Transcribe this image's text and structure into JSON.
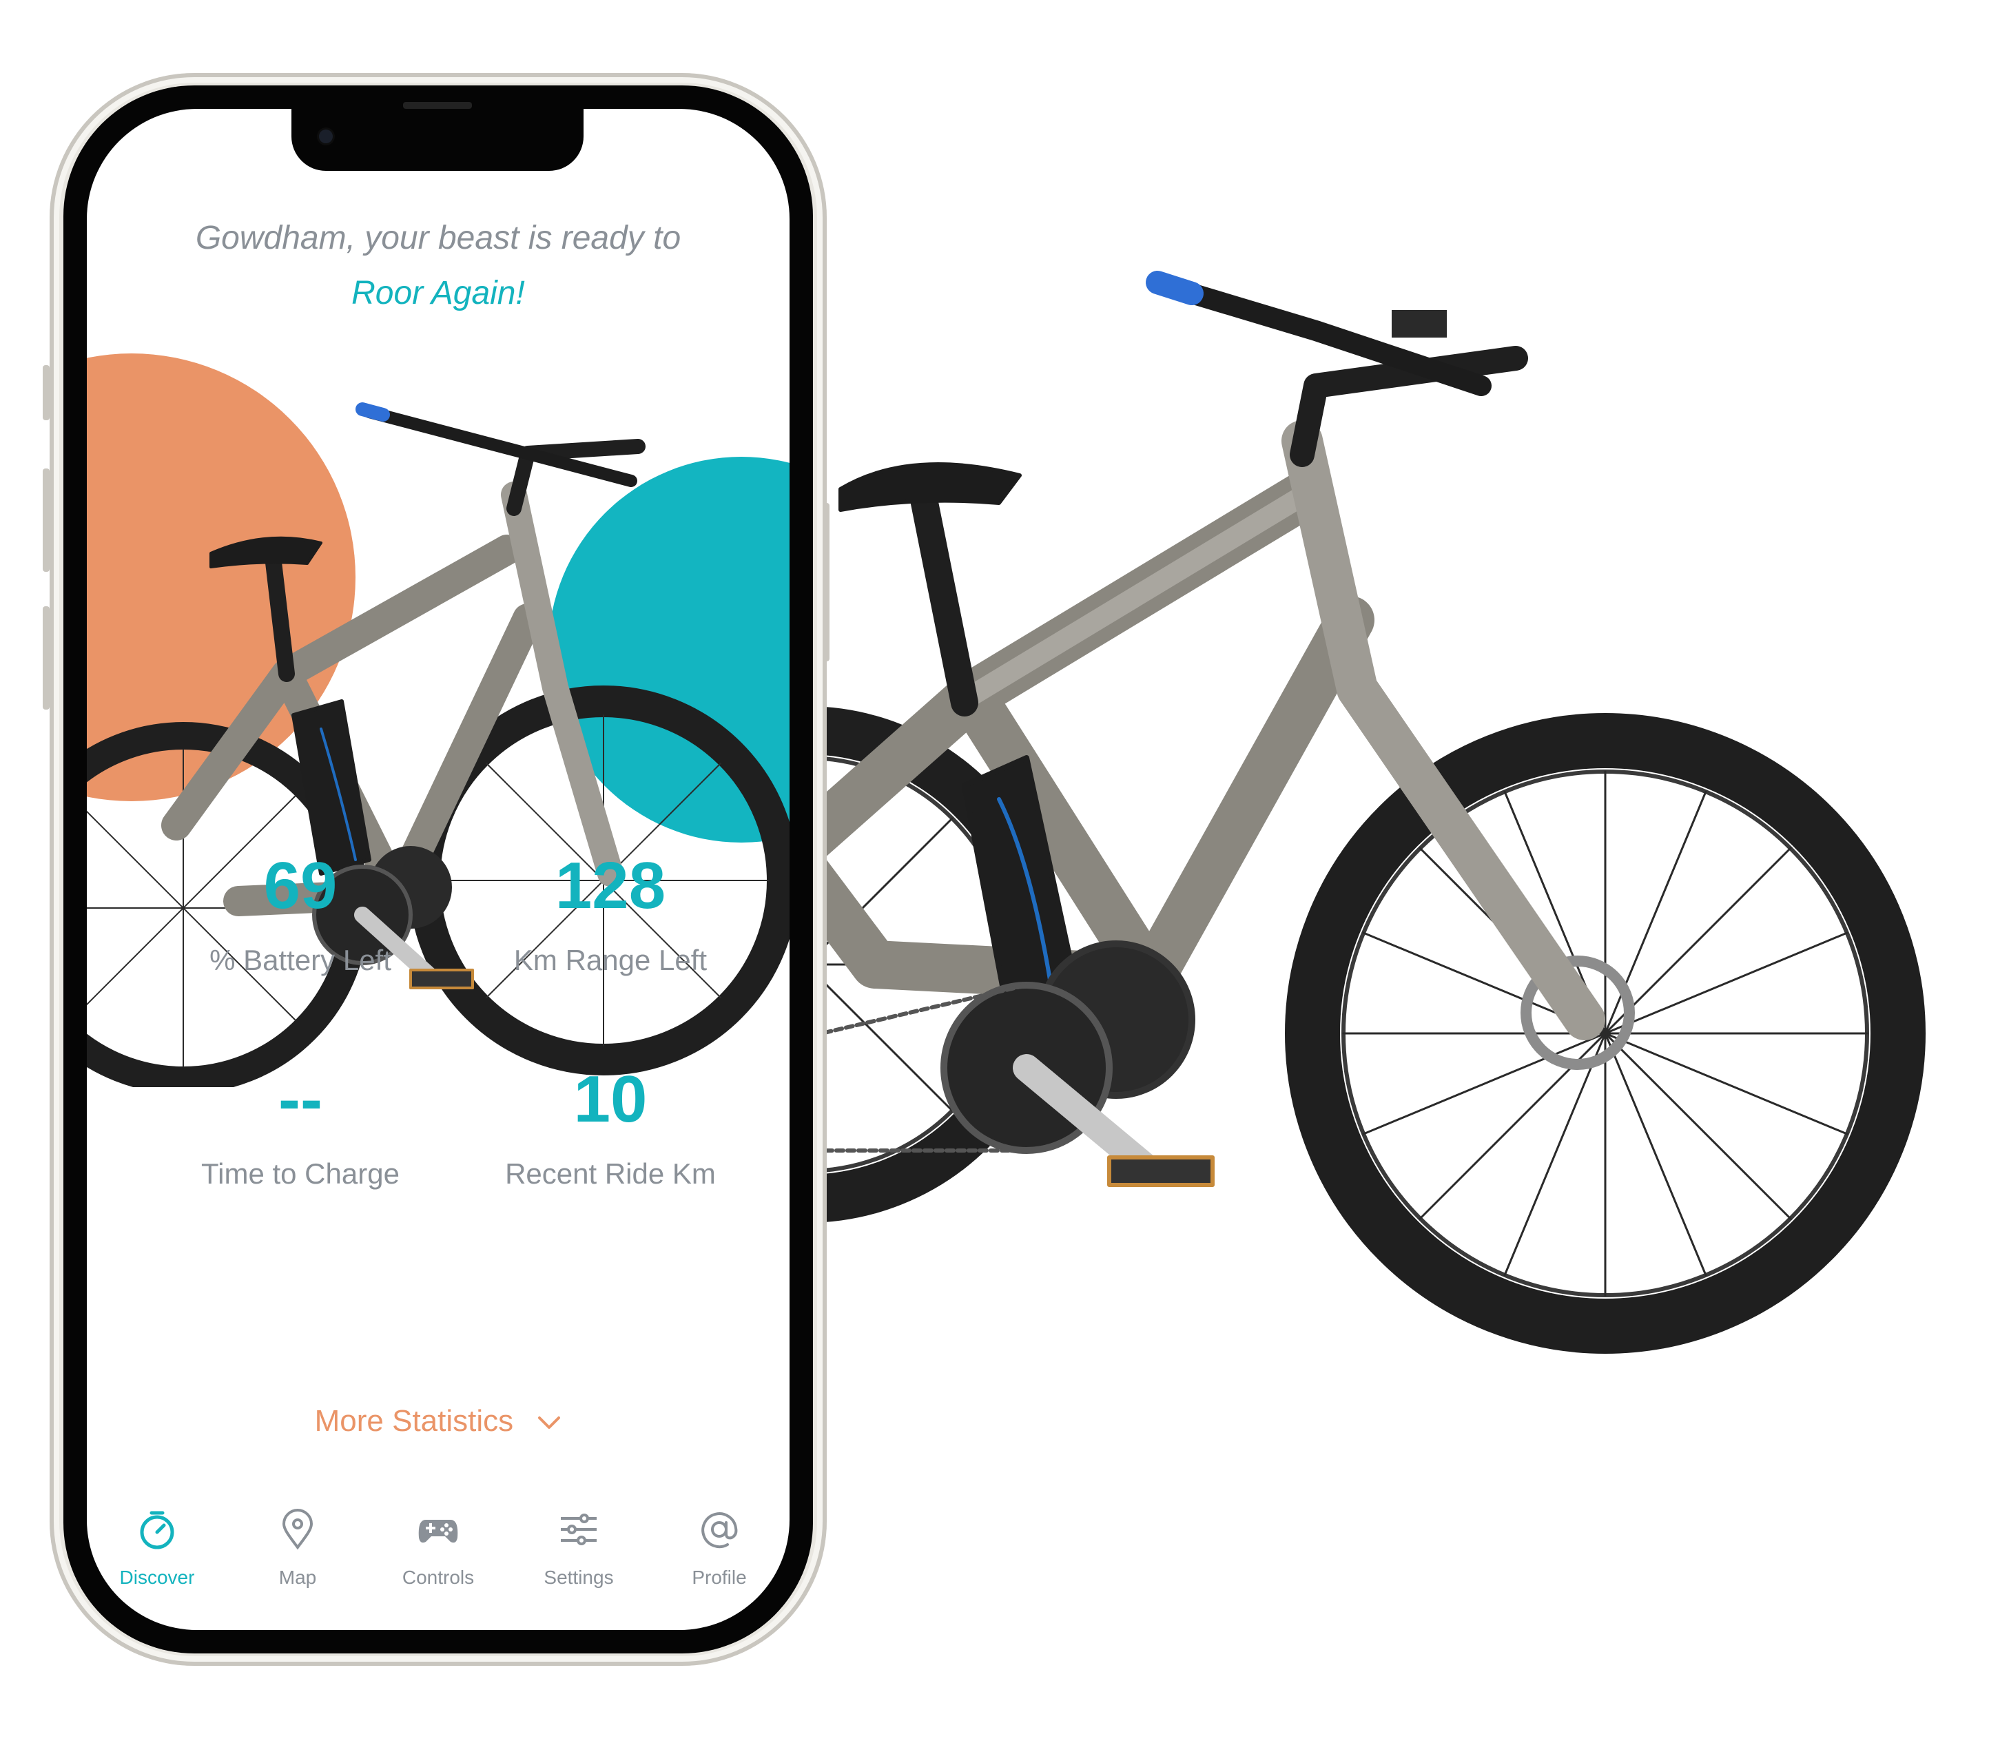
{
  "greeting": {
    "line1": "Gowdham, your beast is ready to",
    "line2": "Roor Again!"
  },
  "stats": [
    {
      "value": "69",
      "label": "% Battery Left"
    },
    {
      "value": "128",
      "label": "Km Range Left"
    },
    {
      "value": "--",
      "label": "Time to Charge"
    },
    {
      "value": "10",
      "label": "Recent Ride Km"
    }
  ],
  "more_statistics": {
    "label": "More Statistics"
  },
  "tabs": [
    {
      "label": "Discover",
      "icon": "stopwatch-icon",
      "active": true
    },
    {
      "label": "Map",
      "icon": "map-pin-icon",
      "active": false
    },
    {
      "label": "Controls",
      "icon": "gamepad-icon",
      "active": false
    },
    {
      "label": "Settings",
      "icon": "sliders-icon",
      "active": false
    },
    {
      "label": "Profile",
      "icon": "at-sign-icon",
      "active": false
    }
  ],
  "colors": {
    "accent": "#13b3be",
    "orange": "#ea9467",
    "muted_text": "#8a9097"
  }
}
